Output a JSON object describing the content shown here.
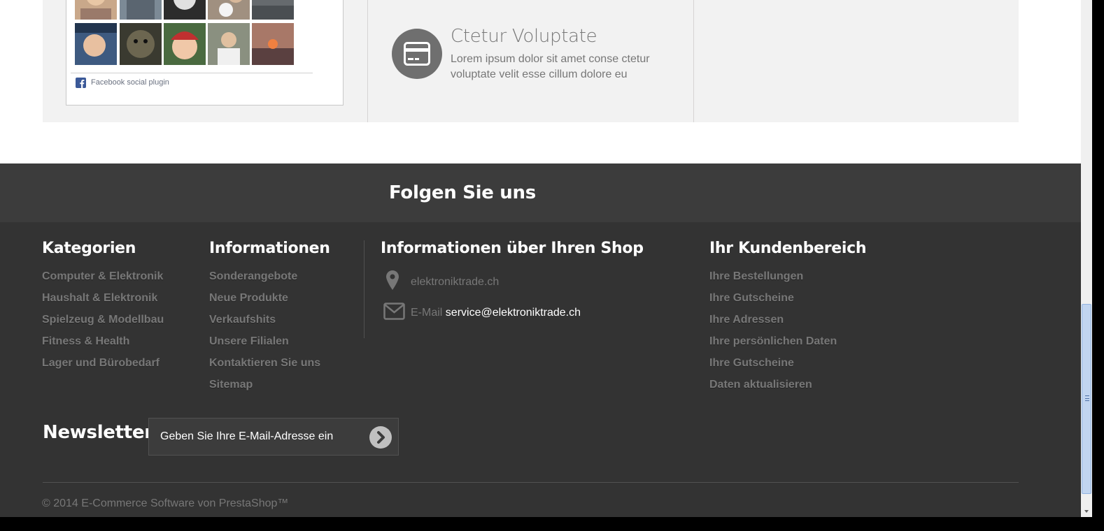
{
  "facebook": {
    "plugin_label": "Facebook social plugin"
  },
  "feature": {
    "title": "Ctetur Voluptate",
    "description": "Lorem ipsum dolor sit amet conse ctetur voluptate velit esse cillum dolore eu",
    "icon": "credit-card-icon"
  },
  "footer": {
    "follow_title": "Folgen Sie uns",
    "categories": {
      "title": "Kategorien",
      "items": [
        "Computer & Elektronik",
        "Haushalt & Elektronik",
        "Spielzeug & Modellbau",
        "Fitness & Health",
        "Lager und Bürobedarf"
      ]
    },
    "information": {
      "title": "Informationen",
      "items": [
        "Sonderangebote",
        "Neue Produkte",
        "Verkaufshits",
        "Unsere Filialen",
        "Kontaktieren Sie uns",
        "Sitemap"
      ]
    },
    "shop_info": {
      "title": "Informationen über Ihren Shop",
      "address": "elektroniktrade.ch",
      "email_label": "E-Mail",
      "email": "service@elektroniktrade.ch"
    },
    "account": {
      "title": "Ihr Kundenbereich",
      "items": [
        "Ihre Bestellungen",
        "Ihre Gutscheine",
        "Ihre Adressen",
        "Ihre persönlichen Daten",
        "Ihre Gutscheine",
        "Daten aktualisieren"
      ]
    },
    "newsletter": {
      "title": "Newsletter",
      "placeholder": "Geben Sie Ihre E-Mail-Adresse ein"
    },
    "copyright": "© 2014 E-Commerce Software von PrestaShop™"
  },
  "colors": {
    "footer_bg": "#333333",
    "follow_bg": "#3c3c3c",
    "link_grey": "#777777",
    "top_band_bg": "#f2f2f2"
  }
}
